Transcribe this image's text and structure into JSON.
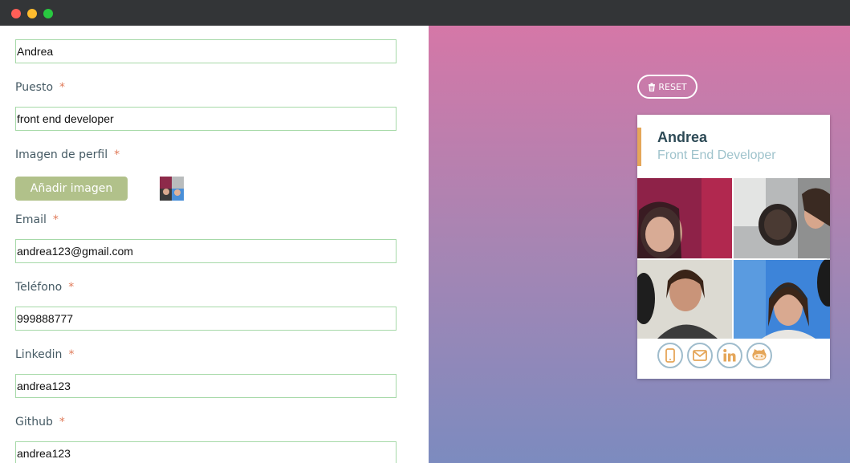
{
  "window": {
    "controls": [
      "close",
      "minimize",
      "maximize"
    ]
  },
  "form": {
    "name_value": "Andrea",
    "job": {
      "label": "Puesto",
      "required": "*",
      "value": "front end developer"
    },
    "image": {
      "label": "Imagen de perfil",
      "required": "*",
      "button_label": "Añadir imagen"
    },
    "email": {
      "label": "Email",
      "required": "*",
      "value": "andrea123@gmail.com"
    },
    "phone": {
      "label": "Teléfono",
      "required": "*",
      "value": "999888777"
    },
    "linkedin": {
      "label": "Linkedin",
      "required": "*",
      "value": "andrea123"
    },
    "github": {
      "label": "Github",
      "required": "*",
      "value": "andrea123"
    }
  },
  "preview": {
    "reset_label": "RESET",
    "card": {
      "name": "Andrea",
      "job": "Front End Developer",
      "icons": [
        "mobile-icon",
        "envelope-icon",
        "linkedin-icon",
        "github-icon"
      ]
    }
  },
  "colors": {
    "accent": "#e5a659",
    "field_border": "#a6d9a8",
    "add_button": "#b1c18a",
    "required_star": "#e07b5a",
    "gradient_top": "#d577a7",
    "gradient_bottom": "#7c8bbf"
  }
}
